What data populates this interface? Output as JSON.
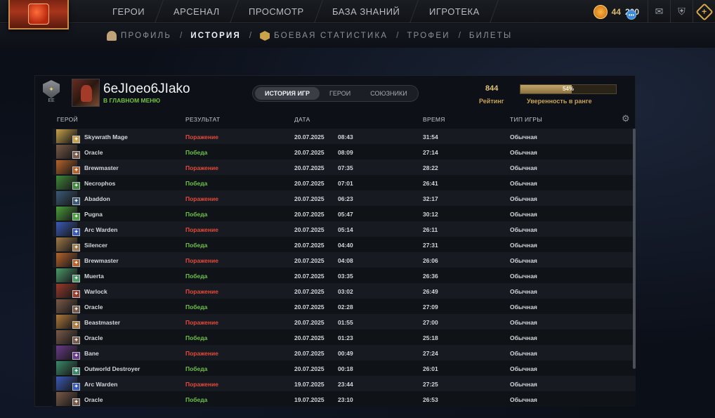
{
  "nav": {
    "items": [
      "ГЕРОИ",
      "АРСЕНАЛ",
      "ПРОСМОТР",
      "БАЗА ЗНАНИЙ",
      "ИГРОТЕКА"
    ],
    "currency_a": "44",
    "currency_b": "200"
  },
  "subnav": {
    "profile": "ПРОФИЛЬ",
    "history": "ИСТОРИЯ",
    "stats": "БОЕВАЯ СТАТИСТИКА",
    "trophies": "ТРОФЕИ",
    "tickets": "БИЛЕТЫ",
    "separator": "/"
  },
  "profile": {
    "username": "6eJIoeo6JIako",
    "status": "В ГЛАВНОМ МЕНЮ",
    "rank_level": "ЕЕ"
  },
  "tabs": [
    "ИСТОРИЯ ИГР",
    "ГЕРОИ",
    "СОЮЗНИКИ"
  ],
  "rating": {
    "value": "844",
    "label": "Рейтинг"
  },
  "confidence": {
    "percent": 54,
    "text": "54%",
    "label": "Уверенность в ранге"
  },
  "columns": {
    "hero": "ГЕРОЙ",
    "result": "РЕЗУЛЬТАТ",
    "date": "ДАТА",
    "duration": "ВРЕМЯ",
    "game_type": "ТИП ИГРЫ"
  },
  "matches": [
    {
      "hero": "Skywrath Mage",
      "result": "Поражение",
      "outcome": "loss",
      "date": "20.07.2025",
      "time": "08:43",
      "duration": "31:54",
      "type": "Обычная",
      "color": "#c9a24a"
    },
    {
      "hero": "Oracle",
      "result": "Победа",
      "outcome": "win",
      "date": "20.07.2025",
      "time": "08:09",
      "duration": "27:14",
      "type": "Обычная",
      "color": "#7a5a48"
    },
    {
      "hero": "Brewmaster",
      "result": "Поражение",
      "outcome": "loss",
      "date": "20.07.2025",
      "time": "07:35",
      "duration": "28:22",
      "type": "Обычная",
      "color": "#b8642a"
    },
    {
      "hero": "Necrophos",
      "result": "Победа",
      "outcome": "win",
      "date": "20.07.2025",
      "time": "07:01",
      "duration": "26:41",
      "type": "Обычная",
      "color": "#3e8a3a"
    },
    {
      "hero": "Abaddon",
      "result": "Поражение",
      "outcome": "loss",
      "date": "20.07.2025",
      "time": "06:23",
      "duration": "32:17",
      "type": "Обычная",
      "color": "#3a5a78"
    },
    {
      "hero": "Pugna",
      "result": "Победа",
      "outcome": "win",
      "date": "20.07.2025",
      "time": "05:47",
      "duration": "30:12",
      "type": "Обычная",
      "color": "#4aa03a"
    },
    {
      "hero": "Arc Warden",
      "result": "Поражение",
      "outcome": "loss",
      "date": "20.07.2025",
      "time": "05:14",
      "duration": "26:11",
      "type": "Обычная",
      "color": "#3a5ab8"
    },
    {
      "hero": "Silencer",
      "result": "Победа",
      "outcome": "win",
      "date": "20.07.2025",
      "time": "04:40",
      "duration": "27:31",
      "type": "Обычная",
      "color": "#a07a48"
    },
    {
      "hero": "Brewmaster",
      "result": "Поражение",
      "outcome": "loss",
      "date": "20.07.2025",
      "time": "04:08",
      "duration": "26:06",
      "type": "Обычная",
      "color": "#b8642a"
    },
    {
      "hero": "Muerta",
      "result": "Победа",
      "outcome": "win",
      "date": "20.07.2025",
      "time": "03:35",
      "duration": "26:36",
      "type": "Обычная",
      "color": "#4a9a6a"
    },
    {
      "hero": "Warlock",
      "result": "Поражение",
      "outcome": "loss",
      "date": "20.07.2025",
      "time": "03:02",
      "duration": "26:49",
      "type": "Обычная",
      "color": "#9a3a2a"
    },
    {
      "hero": "Oracle",
      "result": "Победа",
      "outcome": "win",
      "date": "20.07.2025",
      "time": "02:28",
      "duration": "27:09",
      "type": "Обычная",
      "color": "#7a5a48"
    },
    {
      "hero": "Beastmaster",
      "result": "Поражение",
      "outcome": "loss",
      "date": "20.07.2025",
      "time": "01:55",
      "duration": "27:00",
      "type": "Обычная",
      "color": "#b07a3a"
    },
    {
      "hero": "Oracle",
      "result": "Победа",
      "outcome": "win",
      "date": "20.07.2025",
      "time": "01:23",
      "duration": "25:18",
      "type": "Обычная",
      "color": "#7a5a48"
    },
    {
      "hero": "Bane",
      "result": "Поражение",
      "outcome": "loss",
      "date": "20.07.2025",
      "time": "00:49",
      "duration": "27:24",
      "type": "Обычная",
      "color": "#6a3a8a"
    },
    {
      "hero": "Outworld Destroyer",
      "result": "Победа",
      "outcome": "win",
      "date": "20.07.2025",
      "time": "00:18",
      "duration": "26:01",
      "type": "Обычная",
      "color": "#3a8a6a"
    },
    {
      "hero": "Arc Warden",
      "result": "Поражение",
      "outcome": "loss",
      "date": "19.07.2025",
      "time": "23:44",
      "duration": "27:25",
      "type": "Обычная",
      "color": "#3a5ab8"
    },
    {
      "hero": "Oracle",
      "result": "Победа",
      "outcome": "win",
      "date": "19.07.2025",
      "time": "23:10",
      "duration": "26:53",
      "type": "Обычная",
      "color": "#7a5a48"
    }
  ]
}
